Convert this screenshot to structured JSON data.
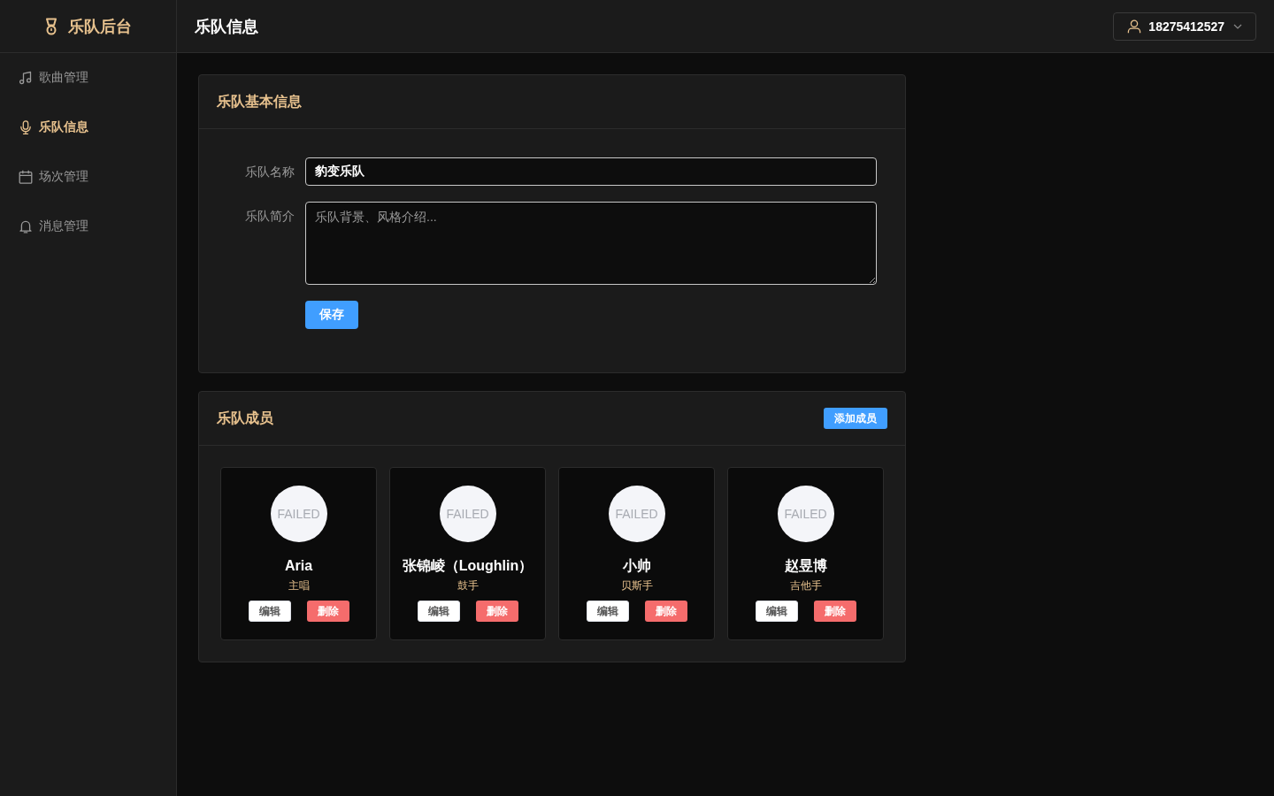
{
  "sidebar": {
    "logo": "乐队后台",
    "items": [
      {
        "label": "歌曲管理",
        "selected": false
      },
      {
        "label": "乐队信息",
        "selected": true
      },
      {
        "label": "场次管理",
        "selected": false
      },
      {
        "label": "消息管理",
        "selected": false
      }
    ]
  },
  "header": {
    "title": "乐队信息",
    "user": "18275412527"
  },
  "basic_info": {
    "title": "乐队基本信息",
    "fields": [
      {
        "kind": "input",
        "label": "乐队名称",
        "value": "豹变乐队"
      },
      {
        "kind": "textarea",
        "label": "乐队简介",
        "placeholder": "乐队背景、风格介绍..."
      }
    ],
    "save_button": "保存"
  },
  "members": {
    "title": "乐队成员",
    "add_button": "添加成员",
    "items": [
      {
        "avatar": "FAILED",
        "name": "Aria",
        "role": "主唱",
        "edit_button": "编辑",
        "delete_button": "删除"
      },
      {
        "avatar": "FAILED",
        "name": "张锦崚（Loughlin）",
        "role": "鼓手",
        "edit_button": "编辑",
        "delete_button": "删除"
      },
      {
        "avatar": "FAILED",
        "name": "小帅",
        "role": "贝斯手",
        "edit_button": "编辑",
        "delete_button": "删除"
      },
      {
        "avatar": "FAILED",
        "name": "赵昱博",
        "role": "吉他手",
        "edit_button": "编辑",
        "delete_button": "删除"
      }
    ]
  }
}
